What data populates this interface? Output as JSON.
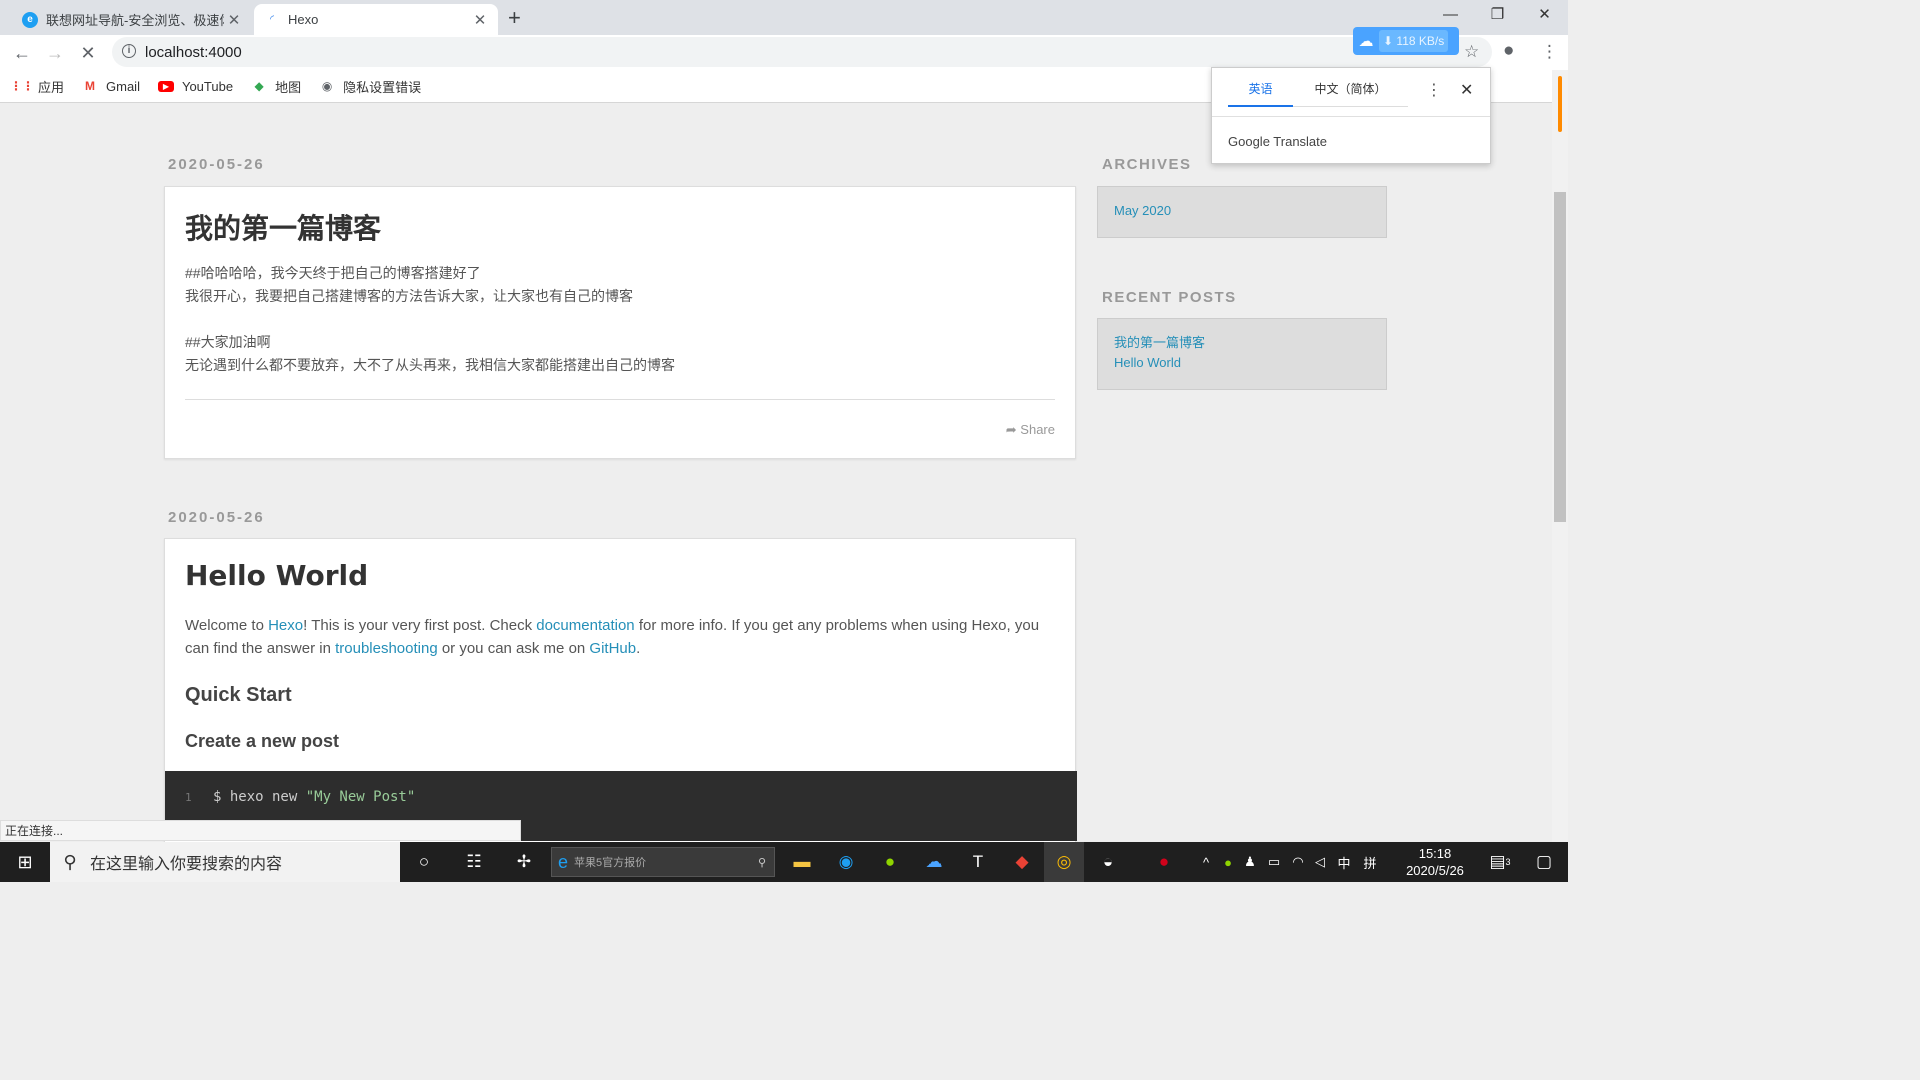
{
  "browser": {
    "tabs": [
      {
        "title": "联想网址导航-安全浏览、极速体",
        "active": false
      },
      {
        "title": "Hexo",
        "active": true
      }
    ],
    "url": "localhost:4000",
    "download_speed": "118 KB/s",
    "bookmarks": [
      {
        "label": "应用",
        "icon": "apps-grid-icon"
      },
      {
        "label": "Gmail",
        "icon": "gmail-icon"
      },
      {
        "label": "YouTube",
        "icon": "youtube-icon"
      },
      {
        "label": "地图",
        "icon": "maps-icon"
      },
      {
        "label": "隐私设置错误",
        "icon": "globe-icon"
      }
    ],
    "status": "正在连接..."
  },
  "translate": {
    "source_lang": "英语",
    "target_lang": "中文（简体）",
    "brand": "Google Translate"
  },
  "posts": [
    {
      "date": "2020-05-26",
      "title": "我的第一篇博客",
      "lines": [
        "##哈哈哈哈，我今天终于把自己的博客搭建好了",
        "我很开心，我要把自己搭建博客的方法告诉大家，让大家也有自己的博客",
        "",
        "##大家加油啊",
        "无论遇到什么都不要放弃，大不了从头再来，我相信大家都能搭建出自己的博客"
      ],
      "share": "Share"
    },
    {
      "date": "2020-05-26",
      "title": "Hello World",
      "intro": {
        "t1": "Welcome to ",
        "l1": "Hexo",
        "t2": "! This is your very first post. Check ",
        "l2": "documentation",
        "t3": " for more info. If you get any problems when using Hexo, you can find the answer in ",
        "l3": "troubleshooting",
        "t4": " or you can ask me on ",
        "l4": "GitHub",
        "t5": "."
      },
      "h2": "Quick Start",
      "h3": "Create a new post",
      "code": {
        "line": "1",
        "prefix": "$ hexo new ",
        "string": "\"My New Post\""
      }
    }
  ],
  "sidebar": {
    "archives_title": "ARCHIVES",
    "archives": [
      "May 2020"
    ],
    "recent_title": "RECENT POSTS",
    "recent": [
      "我的第一篇博客",
      "Hello World"
    ]
  },
  "taskbar": {
    "search_placeholder": "在这里输入你要搜索的内容",
    "ie_search_placeholder": "苹果5官方报价",
    "ime": "中",
    "ime2": "拼",
    "time": "15:18",
    "date": "2020/5/26",
    "notif_count": "3"
  }
}
